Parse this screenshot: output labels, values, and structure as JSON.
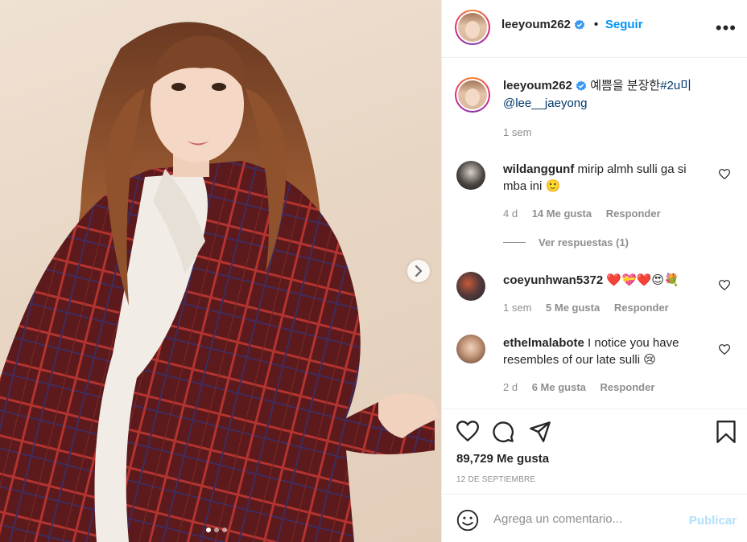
{
  "post": {
    "image_alt": "Foto de la publicación",
    "carousel_dots": 3,
    "active_dot": 0
  },
  "header": {
    "username": "leeyoum262",
    "separator": "•",
    "follow_label": "Seguir",
    "more_label": "•••"
  },
  "caption": {
    "username": "leeyoum262",
    "text": " 예쁨을 분장한",
    "hashtag": "#2u미",
    "mention": "@lee__jaeyong",
    "time": "1 sem"
  },
  "comments": [
    {
      "username": "wildanggunf",
      "text": " mirip almh sulli ga si mba ini 🙂",
      "time": "4 d",
      "likes": "14 Me gusta",
      "reply": "Responder",
      "view_replies": "Ver respuestas (1)"
    },
    {
      "username": "coeyunhwan5372",
      "text": " ❤️💝❤️😍💐",
      "time": "1 sem",
      "likes": "5 Me gusta",
      "reply": "Responder"
    },
    {
      "username": "ethelmalabote",
      "text": " I notice you have resembles of our late sulli 😢",
      "time": "2 d",
      "likes": "6 Me gusta",
      "reply": "Responder"
    }
  ],
  "actions": {
    "likes": "89,729 Me gusta",
    "date": "12 de septiembre"
  },
  "composer": {
    "placeholder": "Agrega un comentario...",
    "publish_label": "Publicar"
  },
  "colors": {
    "accent": "#0095f6",
    "muted": "#8e8e8e",
    "text": "#262626",
    "link": "#00376b",
    "publish_disabled": "#b2dffc"
  },
  "icons": [
    "verified-icon",
    "more-icon",
    "heart-icon",
    "comment-icon",
    "share-icon",
    "bookmark-icon",
    "emoji-icon",
    "chevron-right-icon"
  ]
}
